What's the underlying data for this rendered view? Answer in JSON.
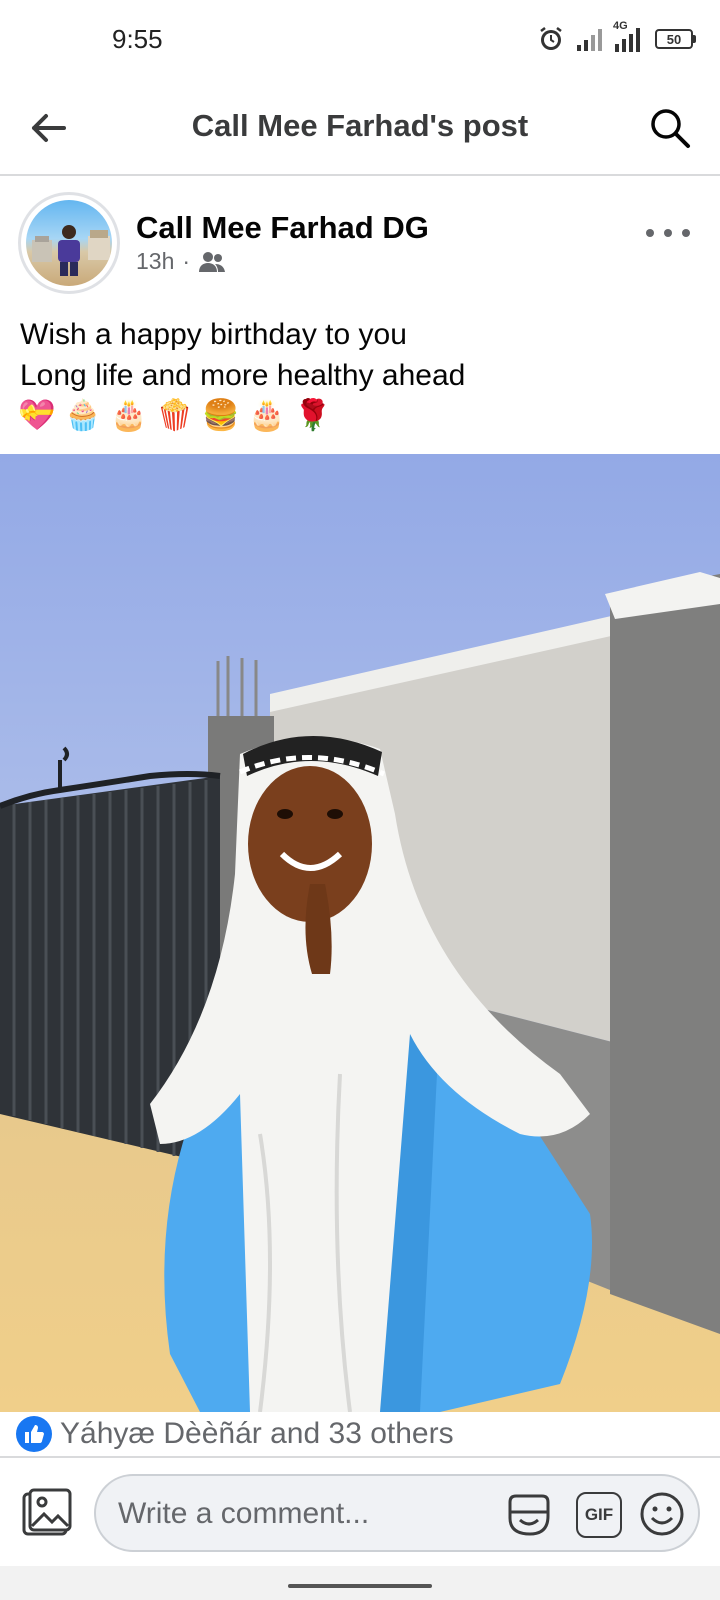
{
  "status_bar": {
    "time": "9:55",
    "network": "4G",
    "battery": "50"
  },
  "app_bar": {
    "title": "Call Mee Farhad's post",
    "back_icon": "arrow-left-icon",
    "search_icon": "search-icon"
  },
  "post": {
    "author": "Call Mee Farhad DG",
    "time": "13h",
    "separator": "·",
    "audience_icon": "friends-icon",
    "text_lines": [
      "Wish a happy birthday to you",
      "Long life and more healthy ahead"
    ],
    "emojis": [
      "💝",
      "🧁",
      "🎂",
      "🍿",
      "🍔",
      "🎂",
      "🌹"
    ]
  },
  "reactions": {
    "summary": "Yáhyæ Dèèñár and 33 others",
    "icon": "like-icon",
    "color": "#1877f2"
  },
  "comment_bar": {
    "placeholder": "Write a comment...",
    "gif_label": "GIF"
  }
}
